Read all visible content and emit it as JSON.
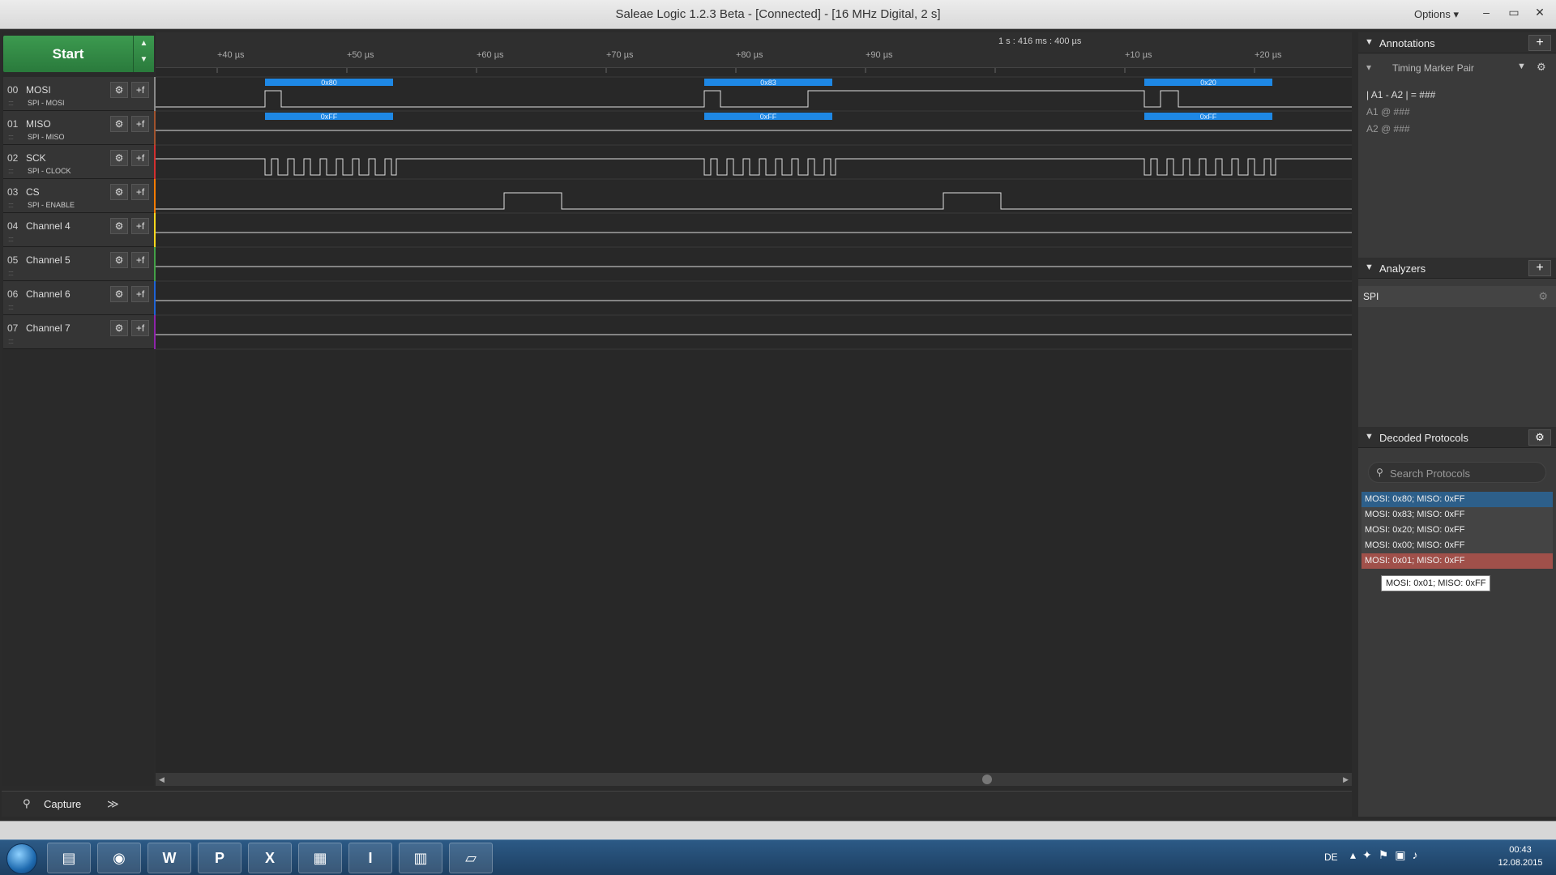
{
  "window": {
    "title": "Saleae Logic 1.2.3 Beta - [Connected] - [16 MHz Digital, 2 s]",
    "options_label": "Options ▾",
    "minimize": "–",
    "restore": "▭",
    "close": "✕"
  },
  "controls": {
    "start_label": "Start"
  },
  "channels": [
    {
      "num": "00",
      "name": "MOSI",
      "sub": "SPI - MOSI",
      "color": "#8a8a8a"
    },
    {
      "num": "01",
      "name": "MISO",
      "sub": "SPI - MISO",
      "color": "#a0522d"
    },
    {
      "num": "02",
      "name": "SCK",
      "sub": "SPI - CLOCK",
      "color": "#d32f2f"
    },
    {
      "num": "03",
      "name": "CS",
      "sub": "SPI - ENABLE",
      "color": "#f57c00"
    },
    {
      "num": "04",
      "name": "Channel 4",
      "sub": "",
      "color": "#f9d71c"
    },
    {
      "num": "05",
      "name": "Channel 5",
      "sub": "",
      "color": "#43a047"
    },
    {
      "num": "06",
      "name": "Channel 6",
      "sub": "",
      "color": "#1e63d6"
    },
    {
      "num": "07",
      "name": "Channel 7",
      "sub": "",
      "color": "#8e24aa"
    }
  ],
  "timeline": {
    "cursor_label": "1 s : 416 ms : 400 µs",
    "ticks": [
      "+40 µs",
      "+50 µs",
      "+60 µs",
      "+70 µs",
      "+80 µs",
      "+90 µs",
      "+10 µs",
      "+20 µs"
    ]
  },
  "decoded_bubbles": {
    "mosi": [
      "0x80",
      "0x83",
      "0x20"
    ],
    "miso": [
      "0xFF",
      "0xFF",
      "0xFF"
    ]
  },
  "capture": {
    "label": "Capture",
    "more": "≫"
  },
  "annotations": {
    "header": "Annotations",
    "marker_label": "Timing Marker Pair",
    "formula": "| A1 - A2 | = ###",
    "a1_line": "A1  @  ###",
    "a2_line": "A2  @  ###"
  },
  "analyzers": {
    "header": "Analyzers",
    "items": [
      "SPI"
    ]
  },
  "decoded_protocols": {
    "header": "Decoded Protocols",
    "search_placeholder": "Search Protocols",
    "rows": [
      {
        "text": "MOSI: 0x80;  MISO: 0xFF",
        "state": "selected"
      },
      {
        "text": "MOSI: 0x83;  MISO: 0xFF",
        "state": "normal"
      },
      {
        "text": "MOSI: 0x20;  MISO: 0xFF",
        "state": "normal"
      },
      {
        "text": "MOSI: 0x00;  MISO: 0xFF",
        "state": "normal"
      },
      {
        "text": "MOSI: 0x01;  MISO: 0xFF",
        "state": "hover"
      }
    ],
    "tooltip": "MOSI: 0x01;  MISO: 0xFF"
  },
  "taskbar": {
    "apps": [
      {
        "name": "explorer",
        "glyph": "▤"
      },
      {
        "name": "chrome",
        "glyph": "◉"
      },
      {
        "name": "word",
        "glyph": "W"
      },
      {
        "name": "powerpoint",
        "glyph": "P"
      },
      {
        "name": "excel",
        "glyph": "X"
      },
      {
        "name": "app-flags",
        "glyph": "▦"
      },
      {
        "name": "app-i",
        "glyph": "I"
      },
      {
        "name": "saleae",
        "glyph": "▥"
      },
      {
        "name": "notepad",
        "glyph": "▱"
      }
    ],
    "lang": "DE",
    "time": "00:43",
    "date": "12.08.2015"
  },
  "colors": {
    "bubble": "#1e88e5",
    "selected_row": "#2d5f8a",
    "hover_row": "#a0504a",
    "start_green": "#2f8a43"
  }
}
